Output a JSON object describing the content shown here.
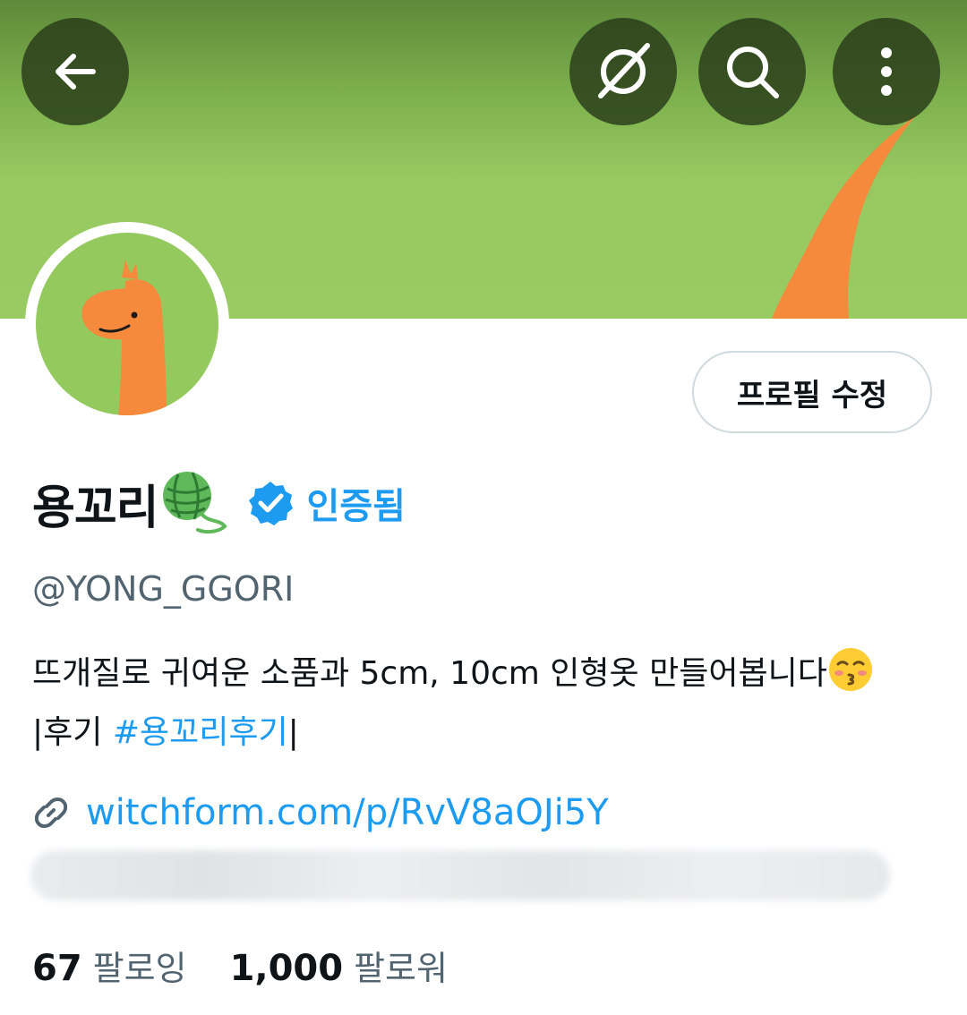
{
  "profile": {
    "display_name": "용꼬리",
    "verified_label": "인증됨",
    "handle": "@YONG_GGORI",
    "bio_line1": "뜨개질로 귀여운 소품과 5cm, 10cm 인형옷 만들어봅니다",
    "bio_line2_prefix": "|후기 ",
    "bio_hashtag": "#용꼬리후기",
    "bio_line2_suffix": "|",
    "link": "witchform.com/p/RvV8aOJi5Y"
  },
  "actions": {
    "edit_profile": "프로필 수정"
  },
  "stats": {
    "following_count": "67",
    "following_label": "팔로잉",
    "followers_count": "1,000",
    "followers_label": "팔로워"
  },
  "icons": {
    "back": "arrow-left-icon",
    "ai": "grok-icon",
    "search": "search-icon",
    "more": "more-vertical-icon",
    "verified": "verified-badge-icon",
    "link": "link-icon",
    "yarn": "yarn-ball-icon",
    "kiss": "kissing-face-icon"
  },
  "colors": {
    "banner_green": "#98cb62",
    "accent_blue": "#1d9bf0",
    "tail_orange": "#f58a3c",
    "secondary_text": "#536471"
  }
}
